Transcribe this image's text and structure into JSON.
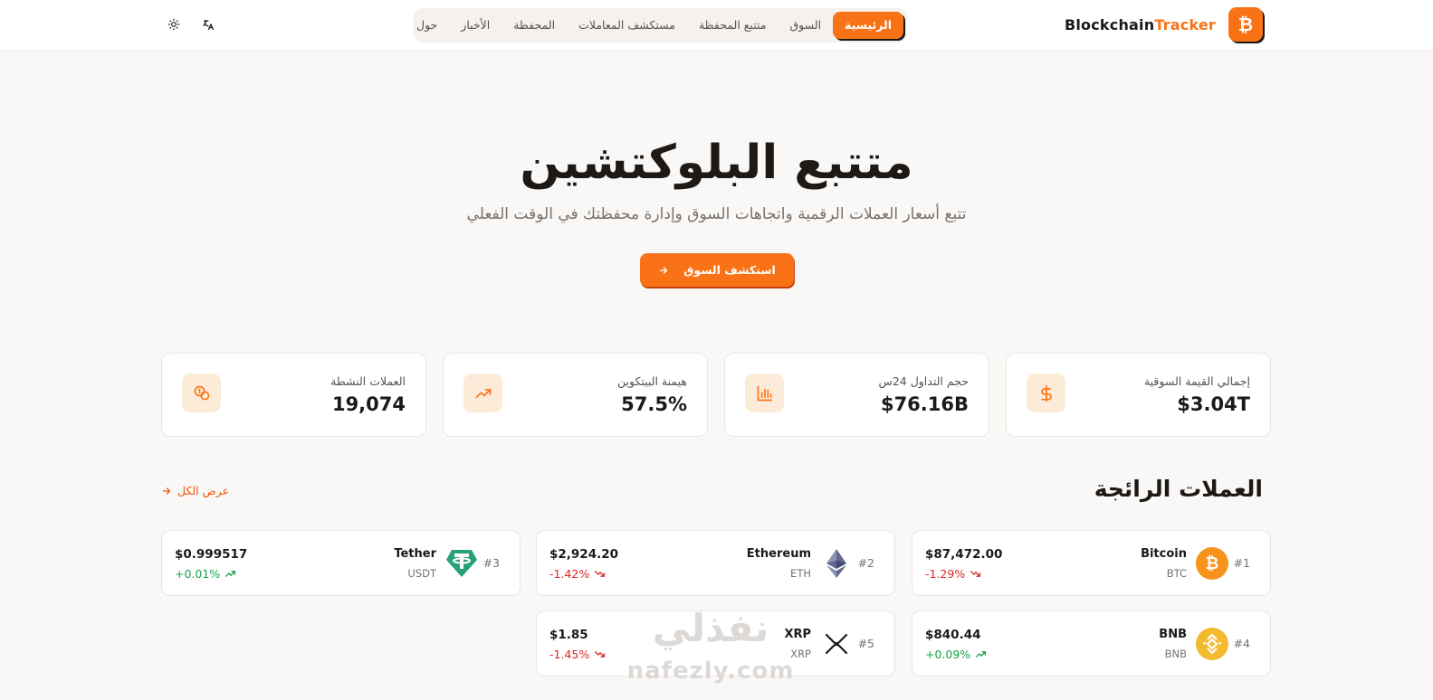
{
  "header": {
    "brand": {
      "name_part1": "Blockchain",
      "name_part2": "Tracker",
      "logo_symbol": "₿"
    },
    "nav": [
      {
        "label": "الرئيسية",
        "active": true
      },
      {
        "label": "السوق",
        "active": false
      },
      {
        "label": "متتبع المحفظة",
        "active": false
      },
      {
        "label": "مستكشف المعاملات",
        "active": false
      },
      {
        "label": "المحفظة",
        "active": false
      },
      {
        "label": "الأخبار",
        "active": false
      },
      {
        "label": "حول",
        "active": false
      }
    ],
    "icons": {
      "language": "translate-icon",
      "theme": "sun-icon"
    }
  },
  "hero": {
    "title": "متتبع البلوكتشين",
    "subtitle": "تتبع أسعار العملات الرقمية واتجاهات السوق وإدارة محفظتك في الوقت الفعلي",
    "cta_label": "استكشف السوق"
  },
  "stats": [
    {
      "label": "إجمالي القيمة السوقية",
      "value": "$3.04T",
      "icon": "dollar-icon"
    },
    {
      "label": "حجم التداول 24س",
      "value": "$76.16B",
      "icon": "bar-chart-icon"
    },
    {
      "label": "هيمنة البيتكوين",
      "value": "57.5%",
      "icon": "trending-up-icon"
    },
    {
      "label": "العملات النشطة",
      "value": "19,074",
      "icon": "coins-icon"
    }
  ],
  "trending": {
    "title": "العملات الرائجة",
    "view_all": "عرض الكل",
    "coins": [
      {
        "rank": "#1",
        "name": "Bitcoin",
        "symbol": "BTC",
        "price": "$87,472.00",
        "change": "-1.29%",
        "direction": "down"
      },
      {
        "rank": "#2",
        "name": "Ethereum",
        "symbol": "ETH",
        "price": "$2,924.20",
        "change": "-1.42%",
        "direction": "down"
      },
      {
        "rank": "#3",
        "name": "Tether",
        "symbol": "USDT",
        "price": "$0.999517",
        "change": "+0.01%",
        "direction": "up"
      },
      {
        "rank": "#4",
        "name": "BNB",
        "symbol": "BNB",
        "price": "$840.44",
        "change": "+0.09%",
        "direction": "up"
      },
      {
        "rank": "#5",
        "name": "XRP",
        "symbol": "XRP",
        "price": "$1.85",
        "change": "-1.45%",
        "direction": "down"
      }
    ]
  },
  "watermark": {
    "arabic": "نفذلي",
    "latin": "nafezly.com"
  },
  "colors": {
    "accent": "#f97316",
    "up": "#16a34a",
    "down": "#dc2626",
    "background": "#faf8f6"
  }
}
